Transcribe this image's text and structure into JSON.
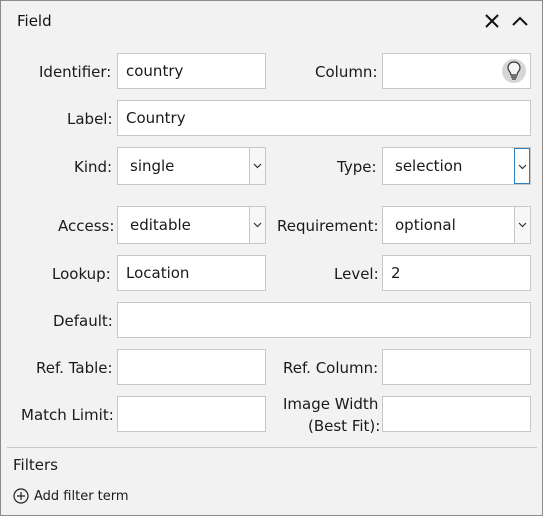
{
  "header": {
    "title": "Field",
    "close_icon": "close-icon",
    "collapse_icon": "chevron-up-icon"
  },
  "form": {
    "identifier": {
      "label": "Identifier:",
      "value": "country"
    },
    "column": {
      "label": "Column:",
      "value": "",
      "hint_icon": "lightbulb-icon"
    },
    "label_field": {
      "label": "Label:",
      "value": "Country"
    },
    "kind": {
      "label": "Kind:",
      "value": "single"
    },
    "type": {
      "label": "Type:",
      "value": "selection"
    },
    "access": {
      "label": "Access:",
      "value": "editable"
    },
    "requirement": {
      "label": "Requirement:",
      "value": "optional"
    },
    "lookup": {
      "label": "Lookup:",
      "value": "Location"
    },
    "level": {
      "label": "Level:",
      "value": "2"
    },
    "default": {
      "label": "Default:",
      "value": ""
    },
    "ref_table": {
      "label": "Ref. Table:",
      "value": ""
    },
    "ref_column": {
      "label": "Ref. Column:",
      "value": ""
    },
    "match_limit": {
      "label": "Match Limit:",
      "value": ""
    },
    "image_width": {
      "label_line1": "Image Width",
      "label_line2": "(Best Fit):",
      "value": ""
    }
  },
  "filters": {
    "title": "Filters",
    "add_label": "Add filter term",
    "add_icon": "plus-circle-icon"
  },
  "colors": {
    "focus_border": "#2b7fc3",
    "field_border": "#c7c7c7",
    "panel_bg": "#f2f2f2"
  }
}
